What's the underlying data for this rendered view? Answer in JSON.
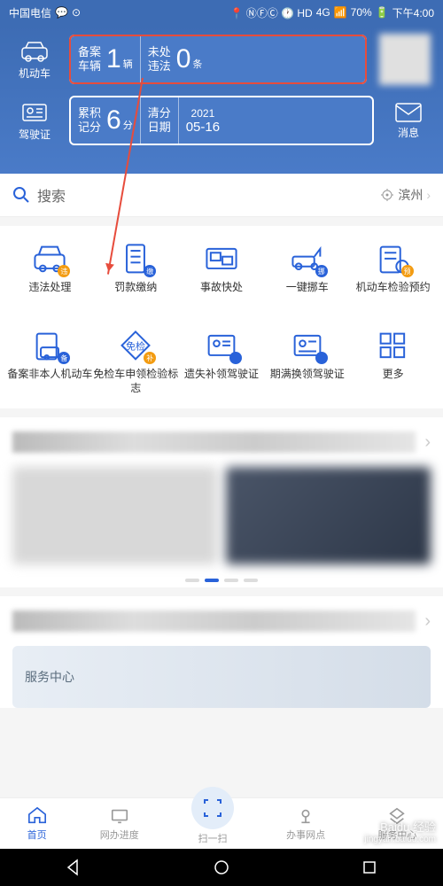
{
  "status": {
    "carrier": "中国电信",
    "time": "下午4:00",
    "battery": "70%",
    "network": "4G"
  },
  "header": {
    "vehicle_label": "机动车",
    "license_label": "驾驶证",
    "message_label": "消息",
    "card1": {
      "seg1_label": "备案\n车辆",
      "seg1_value": "1",
      "seg1_unit": "辆",
      "seg2_label": "未处\n违法",
      "seg2_value": "0",
      "seg2_unit": "条"
    },
    "card2": {
      "seg1_label": "累积\n记分",
      "seg1_value": "6",
      "seg1_unit": "分",
      "seg2_label": "清分\n日期",
      "seg2_year": "2021",
      "seg2_date": "05-16"
    }
  },
  "search": {
    "placeholder": "搜索",
    "city": "滨州"
  },
  "grid": [
    {
      "label": "违法处理",
      "icon": "car-violation",
      "badge": "违",
      "badge_color": "orange"
    },
    {
      "label": "罚款缴纳",
      "icon": "receipt",
      "badge": "缴",
      "badge_color": "blue"
    },
    {
      "label": "事故快处",
      "icon": "accident",
      "badge": "",
      "badge_color": ""
    },
    {
      "label": "一键挪车",
      "icon": "tow",
      "badge": "挪",
      "badge_color": "blue"
    },
    {
      "label": "机动车检验预约",
      "icon": "inspection",
      "badge": "预",
      "badge_color": "orange"
    },
    {
      "label": "备案非本人机动车",
      "icon": "register",
      "badge": "备",
      "badge_color": "blue"
    },
    {
      "label": "免检车申领检验标志",
      "icon": "exempt",
      "badge": "补",
      "badge_color": "orange"
    },
    {
      "label": "遗失补领驾驶证",
      "icon": "lost-license",
      "badge": "",
      "badge_color": "blue"
    },
    {
      "label": "期满换领驾驶证",
      "icon": "renew-license",
      "badge": "",
      "badge_color": "blue"
    },
    {
      "label": "更多",
      "icon": "more",
      "badge": "",
      "badge_color": ""
    }
  ],
  "banner_text": "服务中心",
  "bottom_nav": [
    {
      "label": "首页",
      "active": true
    },
    {
      "label": "网办进度",
      "active": false
    },
    {
      "label": "扫一扫",
      "active": false
    },
    {
      "label": "办事网点",
      "active": false
    },
    {
      "label": "服务中心",
      "active": false
    }
  ],
  "watermark": {
    "brand": "Baidu 经验",
    "url": "jingyan.baidu.com"
  }
}
